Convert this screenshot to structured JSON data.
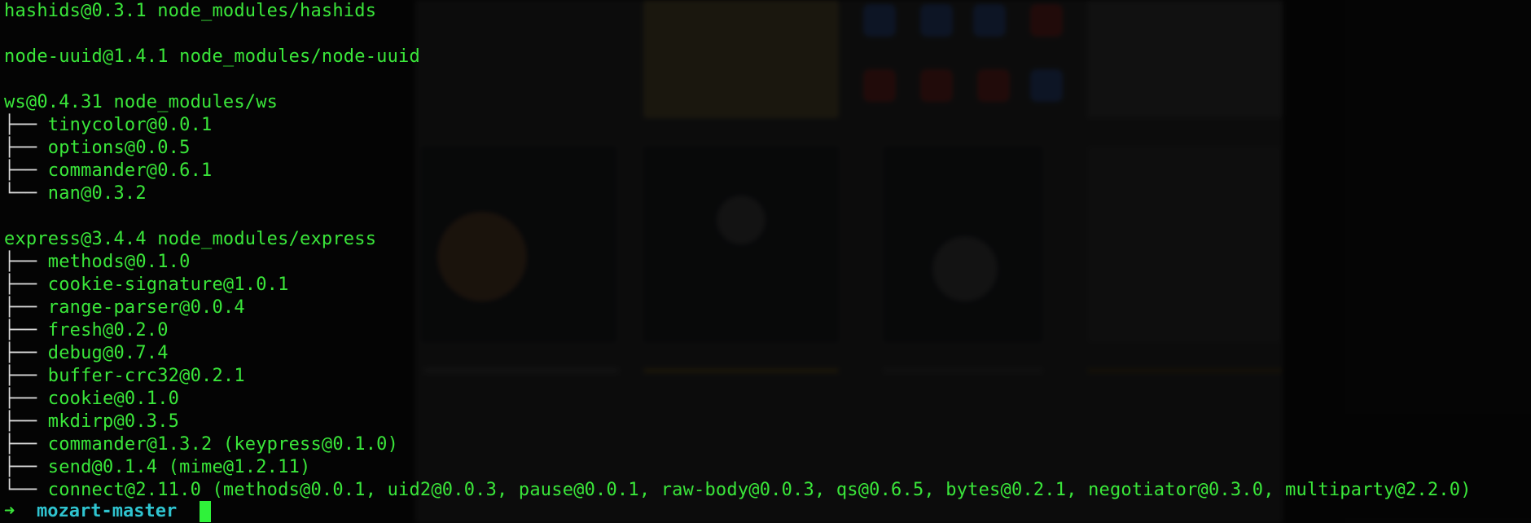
{
  "terminal": {
    "lines": [
      {
        "tree": "",
        "text": "hashids@0.3.1 node_modules/hashids"
      },
      {
        "tree": "",
        "text": ""
      },
      {
        "tree": "",
        "text": "node-uuid@1.4.1 node_modules/node-uuid"
      },
      {
        "tree": "",
        "text": ""
      },
      {
        "tree": "",
        "text": "ws@0.4.31 node_modules/ws"
      },
      {
        "tree": "├── ",
        "text": "tinycolor@0.0.1"
      },
      {
        "tree": "├── ",
        "text": "options@0.0.5"
      },
      {
        "tree": "├── ",
        "text": "commander@0.6.1"
      },
      {
        "tree": "└── ",
        "text": "nan@0.3.2"
      },
      {
        "tree": "",
        "text": ""
      },
      {
        "tree": "",
        "text": "express@3.4.4 node_modules/express"
      },
      {
        "tree": "├── ",
        "text": "methods@0.1.0"
      },
      {
        "tree": "├── ",
        "text": "cookie-signature@1.0.1"
      },
      {
        "tree": "├── ",
        "text": "range-parser@0.0.4"
      },
      {
        "tree": "├── ",
        "text": "fresh@0.2.0"
      },
      {
        "tree": "├── ",
        "text": "debug@0.7.4"
      },
      {
        "tree": "├── ",
        "text": "buffer-crc32@0.2.1"
      },
      {
        "tree": "├── ",
        "text": "cookie@0.1.0"
      },
      {
        "tree": "├── ",
        "text": "mkdirp@0.3.5"
      },
      {
        "tree": "├── ",
        "text": "commander@1.3.2 (keypress@0.1.0)"
      },
      {
        "tree": "├── ",
        "text": "send@0.1.4 (mime@1.2.11)"
      },
      {
        "tree": "└── ",
        "text": "connect@2.11.0 (methods@0.0.1, uid2@0.0.3, pause@0.0.1, raw-body@0.0.3, qs@0.6.5, bytes@0.2.1, negotiator@0.3.0, multiparty@2.2.0)"
      }
    ],
    "prompt": {
      "arrow": "➜",
      "directory": "mozart-master"
    }
  },
  "colors": {
    "text_green": "#3ae63a",
    "prompt_cyan": "#2fc4d0",
    "cursor_green": "#2ff23a",
    "background": "#0b0b0b"
  }
}
